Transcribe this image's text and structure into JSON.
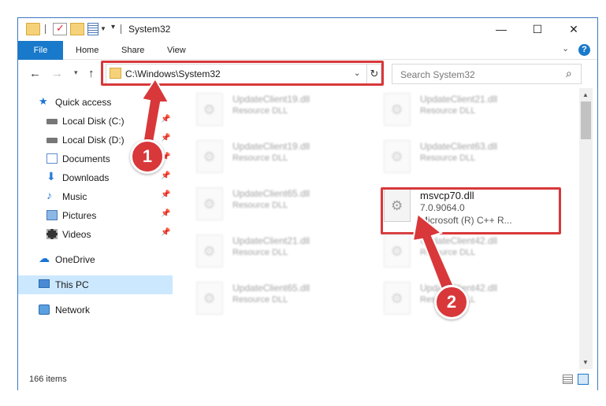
{
  "window": {
    "title": "System32",
    "controls": {
      "minimize": "—",
      "maximize": "☐",
      "close": "✕"
    }
  },
  "ribbon": {
    "tabs": [
      "File",
      "Home",
      "Share",
      "View"
    ]
  },
  "navigation": {
    "address": "C:\\Windows\\System32",
    "search_placeholder": "Search System32"
  },
  "sidebar": {
    "items": [
      {
        "label": "Quick access",
        "icon": "star-icon",
        "pinned": false
      },
      {
        "label": "Local Disk (C:)",
        "icon": "disk-icon",
        "pinned": true
      },
      {
        "label": "Local Disk (D:)",
        "icon": "disk-icon",
        "pinned": true
      },
      {
        "label": "Documents",
        "icon": "documents-icon",
        "pinned": true
      },
      {
        "label": "Downloads",
        "icon": "download-icon",
        "pinned": true
      },
      {
        "label": "Music",
        "icon": "music-icon",
        "pinned": true
      },
      {
        "label": "Pictures",
        "icon": "pictures-icon",
        "pinned": true
      },
      {
        "label": "Videos",
        "icon": "videos-icon",
        "pinned": true
      },
      {
        "label": "OneDrive",
        "icon": "cloud-icon",
        "pinned": false
      },
      {
        "label": "This PC",
        "icon": "pc-icon",
        "pinned": false,
        "selected": true
      },
      {
        "label": "Network",
        "icon": "network-icon",
        "pinned": false
      }
    ]
  },
  "files": {
    "background": [
      {
        "name": "UpdateClient19.dll",
        "type": "Resource DLL"
      },
      {
        "name": "UpdateClient21.dll",
        "type": "Resource DLL"
      },
      {
        "name": "UpdateClient19.dll",
        "type": "Resource DLL"
      },
      {
        "name": "UpdateClient63.dll",
        "type": "Resource DLL"
      },
      {
        "name": "UpdateClient65.dll",
        "type": "Resource DLL"
      },
      {
        "name": "UpdateClient21.dll",
        "type": "Resource DLL"
      },
      {
        "name": "UpdateClient42.dll",
        "type": "Resource DLL"
      },
      {
        "name": "UpdateClient65.dll",
        "type": "Resource DLL"
      },
      {
        "name": "UpdateClient42.dll",
        "type": "Resource DLL"
      }
    ],
    "highlighted": {
      "name": "msvcp70.dll",
      "version": "7.0.9064.0",
      "description": "Microsoft (R) C++ R..."
    }
  },
  "status": {
    "item_count": "166 items"
  },
  "annotations": {
    "badge1": "1",
    "badge2": "2",
    "accent_color": "#d8383a"
  }
}
